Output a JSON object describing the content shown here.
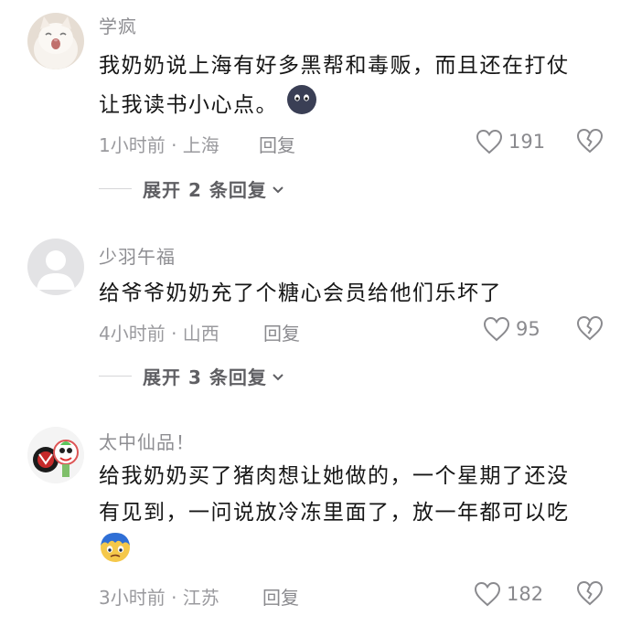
{
  "comments": [
    {
      "username": "学疯",
      "text_lines": [
        "我奶奶说上海有好多黑帮和毒贩，而且还在打仗",
        "让我读书小心点。"
      ],
      "time": "1小时前",
      "location": "上海",
      "meta": "1小时前 · 上海",
      "reply_label": "回复",
      "likes": "191",
      "expand_label": "展开 2 条回复",
      "emoji": "dark-round-face-emoji"
    },
    {
      "username": "少羽午福",
      "text_lines": [
        "给爷爷奶奶充了个糖心会员给他们乐坏了"
      ],
      "time": "4小时前",
      "location": "山西",
      "meta": "4小时前 · 山西",
      "reply_label": "回复",
      "likes": "95",
      "expand_label": "展开 3 条回复"
    },
    {
      "username": "太中仙品！",
      "text_lines": [
        "给我奶奶买了猪肉想让她做的，一个星期了还没",
        "有见到，一问说放冷冻里面了，放一年都可以吃"
      ],
      "time": "3小时前",
      "location": "江苏",
      "meta": "3小时前 · 江苏",
      "reply_label": "回复",
      "likes": "182",
      "emoji": "blue-crying-face-emoji"
    }
  ],
  "icons": {
    "like": "heart-outline-icon",
    "dislike": "broken-heart-icon",
    "expand": "chevron-down-icon"
  },
  "colors": {
    "text": "#161616",
    "muted": "#8e8e92",
    "divider": "#d6d6d8"
  }
}
